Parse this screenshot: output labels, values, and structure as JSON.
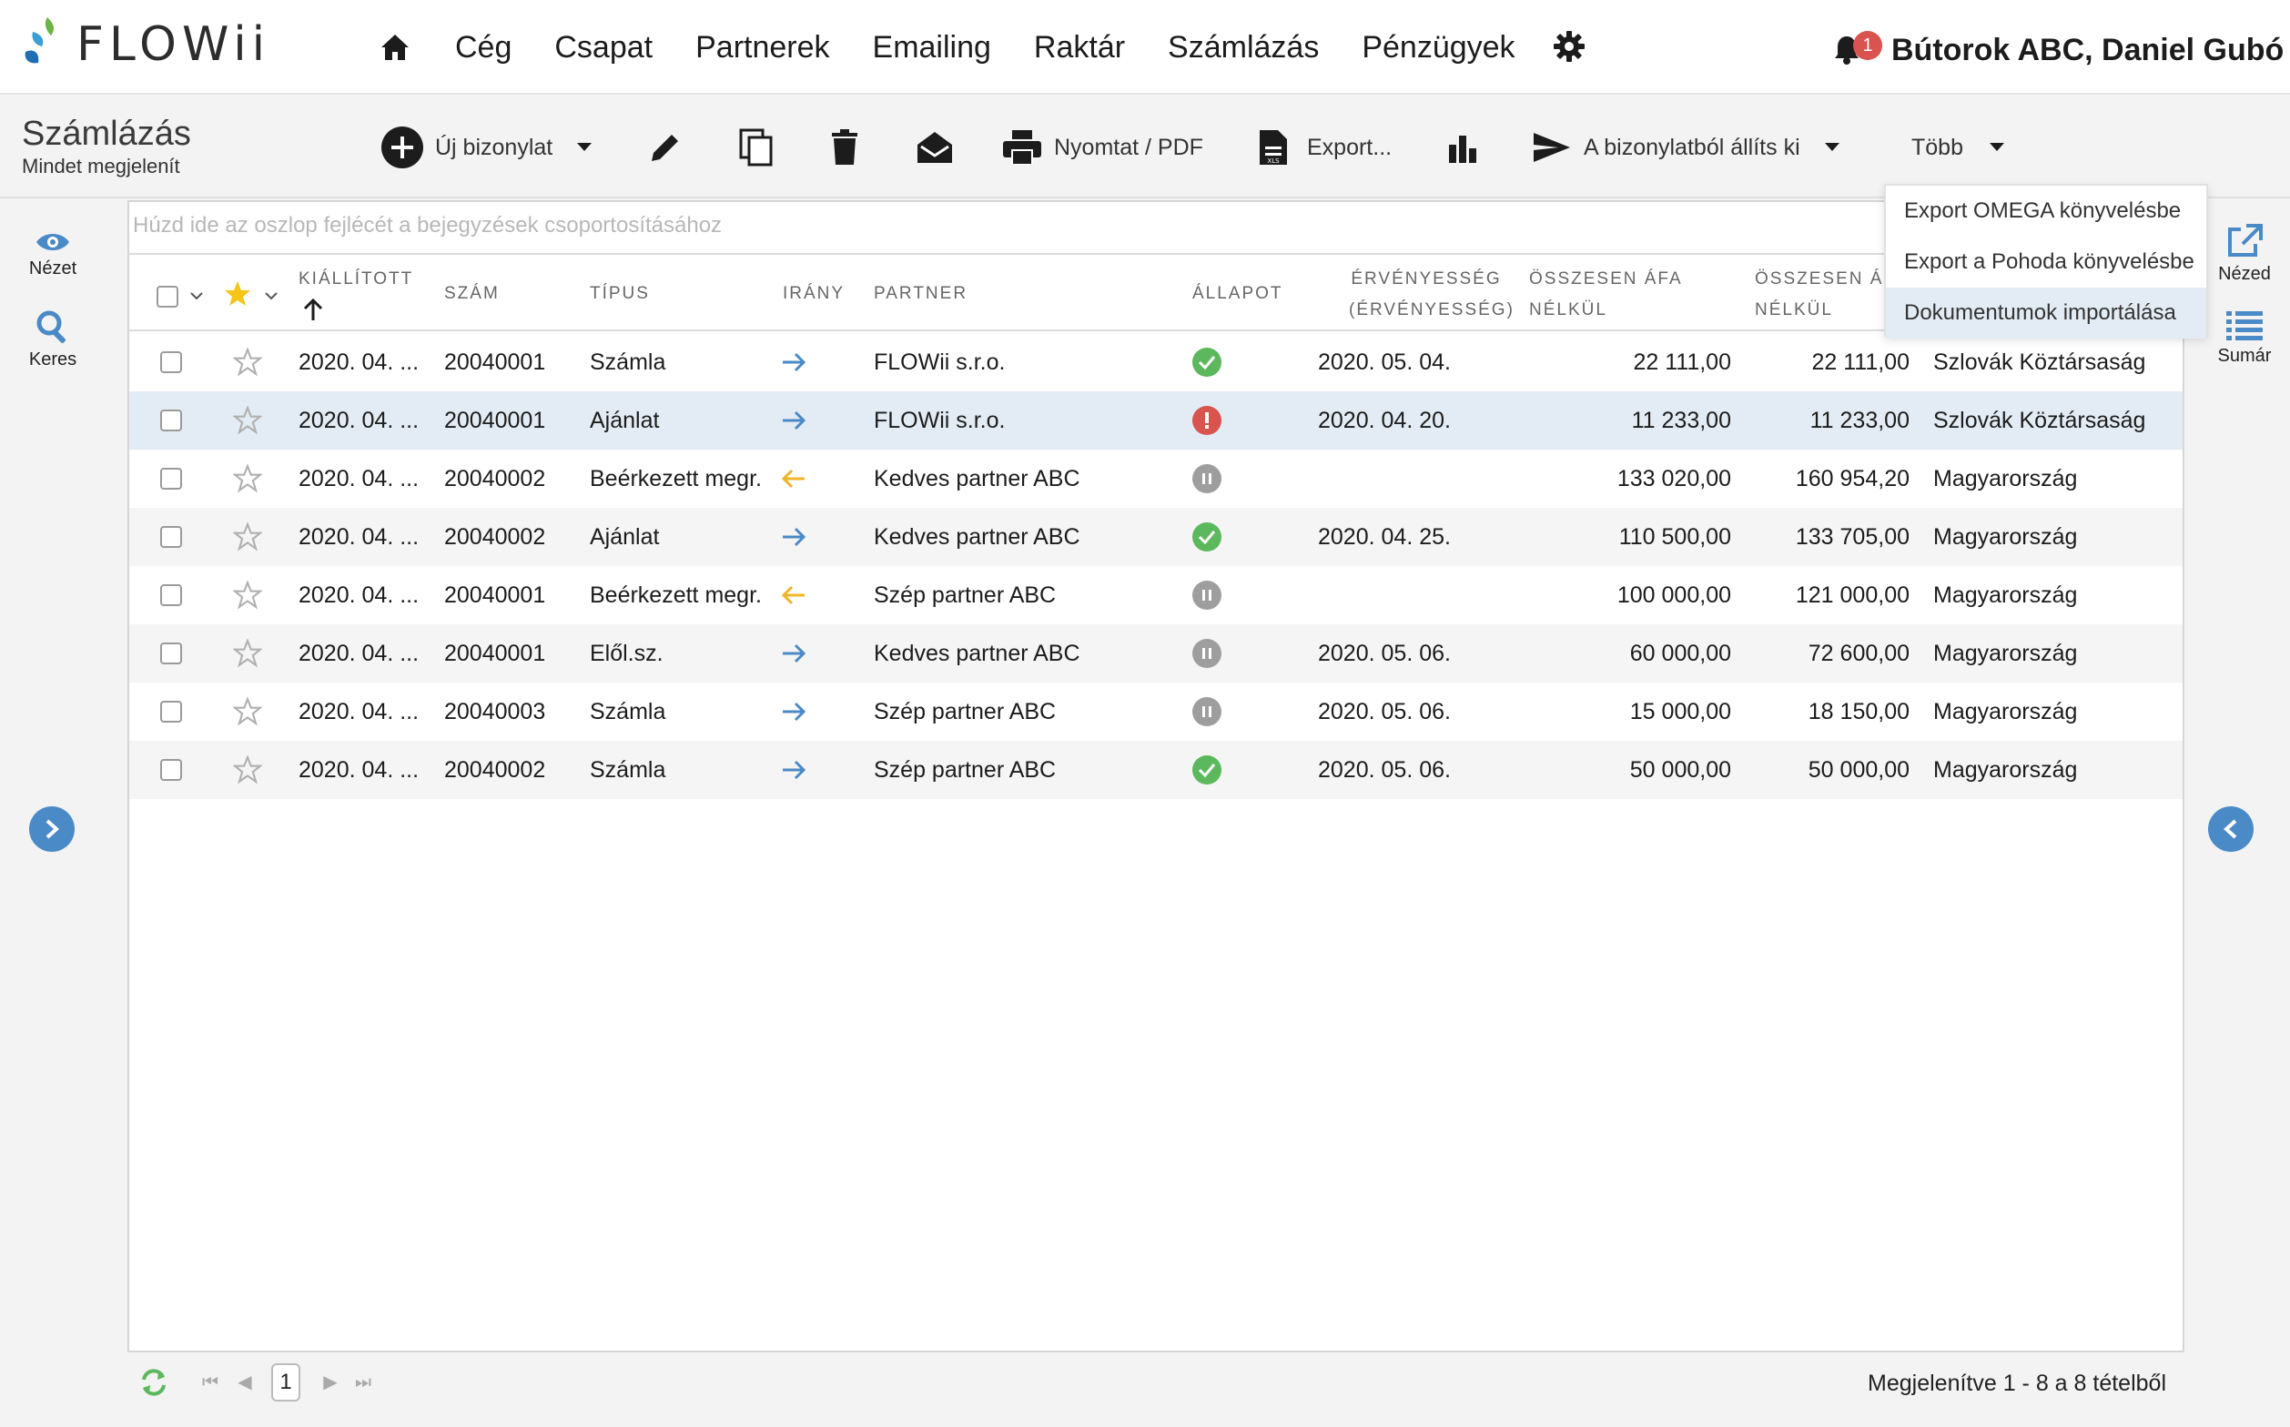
{
  "app": {
    "name": "FLOWii"
  },
  "nav": {
    "items": [
      "Cég",
      "Csapat",
      "Partnerek",
      "Emailing",
      "Raktár",
      "Számlázás",
      "Pénzügyek"
    ],
    "notification_count": "1",
    "user": "Bútorok ABC, Daniel Gubó"
  },
  "page": {
    "title": "Számlázás",
    "subtitle": "Mindet megjelenít"
  },
  "toolbar": {
    "new_doc": "Új bizonylat",
    "print": "Nyomtat / PDF",
    "export": "Export...",
    "issue_from": "A bizonylatból állíts ki",
    "more": "Több"
  },
  "dropdown": {
    "items": [
      "Export OMEGA könyvelésbe",
      "Export a Pohoda könyvelésbe",
      "Dokumentumok importálása"
    ],
    "highlighted": 2
  },
  "left_sidebar": {
    "view": "Nézet",
    "search": "Keres"
  },
  "right_sidebar": {
    "view": "Nézed",
    "summary": "Sumár"
  },
  "table": {
    "group_hint": "Húzd ide az oszlop fejlécét a bejegyzések csoportosításához",
    "headers": {
      "issued": "KIÁLLÍTOTT",
      "number": "SZÁM",
      "type": "TÍPUS",
      "direction": "IRÁNY",
      "partner": "PARTNER",
      "status": "ÁLLAPOT",
      "validity_1": "ÉRVÉNYESSÉG",
      "validity_2": "(ÉRVÉNYESSÉG)",
      "net_1": "ÖSSZESEN ÁFA",
      "net_2": "NÉLKÜL",
      "gross_1": "ÖSSZESEN ÁFA",
      "gross_2": "NÉLKÜL"
    },
    "rows": [
      {
        "issued": "2020. 04. ...",
        "number": "20040001",
        "type": "Számla",
        "direction": "out",
        "partner": "FLOWii s.r.o.",
        "status": "ok",
        "validity": "2020. 05. 04.",
        "net": "22 111,00",
        "gross": "22 111,00",
        "country": "Szlovák Köztársaság"
      },
      {
        "issued": "2020. 04. ...",
        "number": "20040001",
        "type": "Ajánlat",
        "direction": "out",
        "partner": "FLOWii s.r.o.",
        "status": "error",
        "validity": "2020. 04. 20.",
        "net": "11 233,00",
        "gross": "11 233,00",
        "country": "Szlovák Köztársaság"
      },
      {
        "issued": "2020. 04. ...",
        "number": "20040002",
        "type": "Beérkezett megr.",
        "direction": "in",
        "partner": "Kedves partner ABC",
        "status": "paused",
        "validity": "",
        "net": "133 020,00",
        "gross": "160 954,20",
        "country": "Magyarország"
      },
      {
        "issued": "2020. 04. ...",
        "number": "20040002",
        "type": "Ajánlat",
        "direction": "out",
        "partner": "Kedves partner ABC",
        "status": "ok",
        "validity": "2020. 04. 25.",
        "net": "110 500,00",
        "gross": "133 705,00",
        "country": "Magyarország"
      },
      {
        "issued": "2020. 04. ...",
        "number": "20040001",
        "type": "Beérkezett megr.",
        "direction": "in",
        "partner": "Szép partner ABC",
        "status": "paused",
        "validity": "",
        "net": "100 000,00",
        "gross": "121 000,00",
        "country": "Magyarország"
      },
      {
        "issued": "2020. 04. ...",
        "number": "20040001",
        "type": "Elől.sz.",
        "direction": "out",
        "partner": "Kedves partner ABC",
        "status": "paused",
        "validity": "2020. 05. 06.",
        "net": "60 000,00",
        "gross": "72 600,00",
        "country": "Magyarország"
      },
      {
        "issued": "2020. 04. ...",
        "number": "20040003",
        "type": "Számla",
        "direction": "out",
        "partner": "Szép partner ABC",
        "status": "paused",
        "validity": "2020. 05. 06.",
        "net": "15 000,00",
        "gross": "18 150,00",
        "country": "Magyarország"
      },
      {
        "issued": "2020. 04. ...",
        "number": "20040002",
        "type": "Számla",
        "direction": "out",
        "partner": "Szép partner ABC",
        "status": "ok",
        "validity": "2020. 05. 06.",
        "net": "50 000,00",
        "gross": "50 000,00",
        "country": "Magyarország"
      }
    ],
    "selected_row": 1
  },
  "footer": {
    "page": "1",
    "info": "Megjelenítve 1 - 8 a 8 tételből"
  },
  "colors": {
    "accent": "#4a8ac7",
    "status_ok": "#5cb85c",
    "status_error": "#d9534f",
    "status_paused": "#9e9e9e",
    "arrow_out": "#4a8ac7",
    "arrow_in": "#f0b429",
    "star_active": "#f5c518"
  }
}
